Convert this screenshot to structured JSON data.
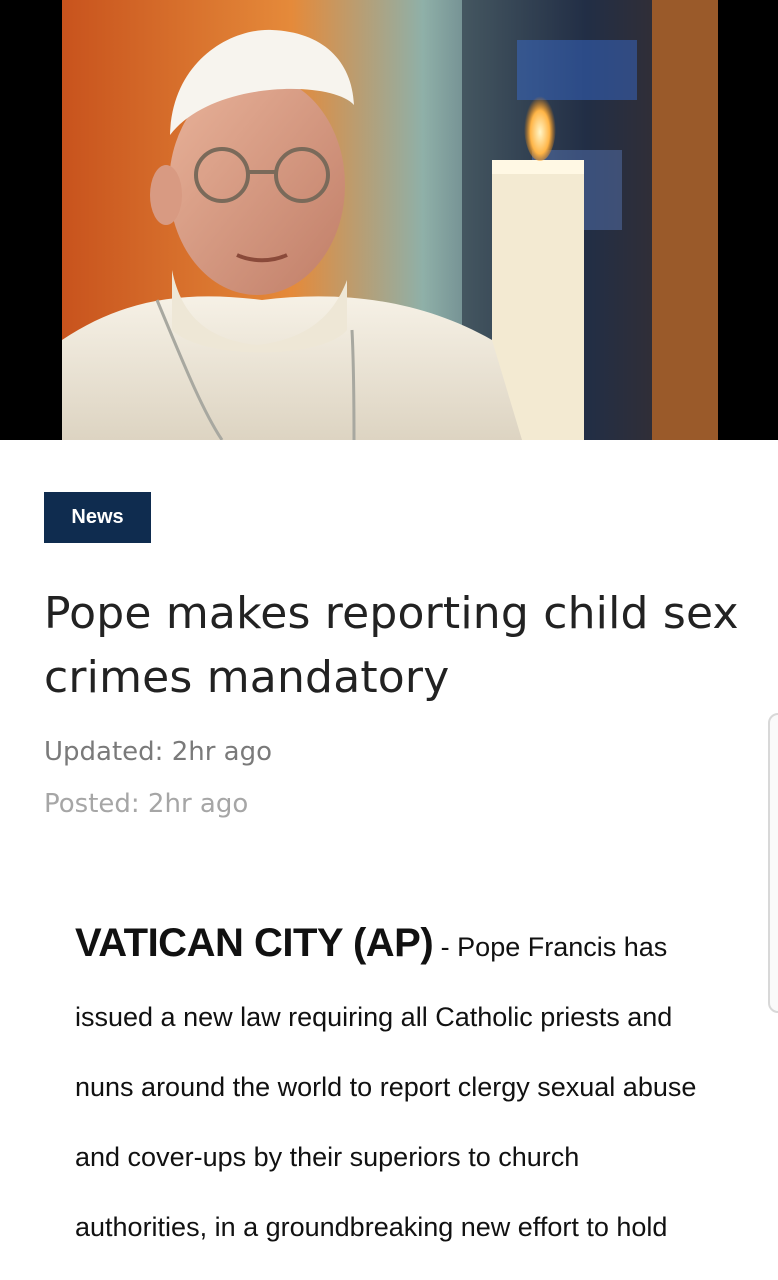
{
  "hero": {
    "image_alt": "Pope Francis beside a lit candle"
  },
  "article": {
    "category": "News",
    "headline": "Pope makes reporting child sex crimes mandatory",
    "updated": "Updated: 2hr ago",
    "posted": "Posted: 2hr ago",
    "dateline": "VATICAN CITY (AP)",
    "separator": " - ",
    "body": "Pope Francis has issued a new law requiring all Catholic priests and nuns around the world to report clergy sexual abuse and cover-ups by their superiors to church authorities, in a groundbreaking new effort to hold"
  },
  "colors": {
    "badge_background": "#0f2c4f",
    "headline_text": "#222222",
    "updated_text": "#7a7a7a",
    "posted_text": "#a6a6a6"
  }
}
